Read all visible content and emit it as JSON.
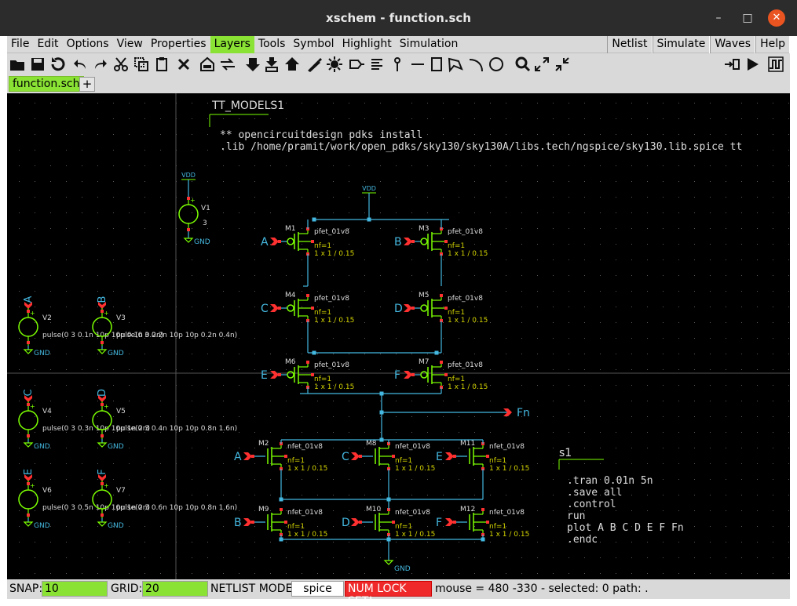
{
  "window": {
    "title": "xschem - function.sch",
    "minimize": "–",
    "maximize": "□",
    "close": "✕"
  },
  "menu": {
    "items": [
      "File",
      "Edit",
      "Options",
      "View",
      "Properties",
      "Layers",
      "Tools",
      "Symbol",
      "Highlight",
      "Simulation"
    ],
    "active": "Layers",
    "right_buttons": [
      "Netlist",
      "Simulate",
      "Waves",
      "Help"
    ]
  },
  "toolbar": {
    "icons": [
      "open-folder-icon",
      "save-icon",
      "reload-icon",
      "undo-icon",
      "redo-icon",
      "cut-icon",
      "copy-icon",
      "paste-icon",
      "delete-icon",
      "place-symbol-icon",
      "move-icon",
      "push-down-icon",
      "make-symbol-icon",
      "pop-up-icon",
      "draw-wire-icon",
      "highlight-net-icon",
      "place-pin-icon",
      "netlabel-icon",
      "place-label-icon",
      "draw-line-icon",
      "draw-rect-icon",
      "draw-polygon-icon",
      "draw-arc-icon",
      "draw-circle-icon",
      "zoom-icon",
      "zoom-in-icon",
      "zoom-out-icon",
      "netlist-icon",
      "simulate-icon",
      "waves-icon"
    ]
  },
  "tabs": [
    {
      "label": "function.sch",
      "active": true
    }
  ],
  "tab_add": "+",
  "schematic": {
    "tt_models_label": "TT_MODELS1",
    "pdk_line1": "** opencircuitdesign pdks install",
    "pdk_line2": ".lib /home/pramit/work/open_pdks/sky130/sky130A/libs.tech/ngspice/sky130.lib.spice tt",
    "vdd": "VDD",
    "gnd": "GND",
    "v1_name": "V1",
    "v1_value": "3",
    "sources": [
      {
        "name": "V2",
        "label": "A",
        "value": "pulse(0 3 0.1n 10p 10p 0.1n 0.2n)"
      },
      {
        "name": "V3",
        "label": "B",
        "value": "pulse(0 3 0.2n 10p 10p 0.2n 0.4n)"
      },
      {
        "name": "V4",
        "label": "C",
        "value": "pulse(0 3 0.3n 10p 10p 1n 2n)"
      },
      {
        "name": "V5",
        "label": "D",
        "value": "pulse(0 3 0.4n 10p 10p 0.8n 1.6n)"
      },
      {
        "name": "V6",
        "label": "E",
        "value": "pulse(0 3 0.5n 10p 10p 1n 2n)"
      },
      {
        "name": "V7",
        "label": "F",
        "value": "pulse(0 3 0.6n 10p 10p 0.8n 1.6n)"
      }
    ],
    "pmos": [
      {
        "name": "M1",
        "gate": "A"
      },
      {
        "name": "M3",
        "gate": "B"
      },
      {
        "name": "M4",
        "gate": "C"
      },
      {
        "name": "M5",
        "gate": "D"
      },
      {
        "name": "M6",
        "gate": "E"
      },
      {
        "name": "M7",
        "gate": "F"
      }
    ],
    "nmos": [
      {
        "name": "M2",
        "gate": "A"
      },
      {
        "name": "M8",
        "gate": "C"
      },
      {
        "name": "M11",
        "gate": "E"
      },
      {
        "name": "M9",
        "gate": "B"
      },
      {
        "name": "M10",
        "gate": "D"
      },
      {
        "name": "M12",
        "gate": "F"
      }
    ],
    "pmos_model": "pfet_01v8",
    "nmos_model": "nfet_01v8",
    "nf": "nf=1",
    "size": "1 x 1 / 0.15",
    "output": "Fn",
    "sim_block_name": "s1",
    "sim_commands": [
      ".tran 0.01n 5n",
      ".save all",
      ".control",
      "run",
      "plot A B C D E F Fn",
      ".endc"
    ]
  },
  "status": {
    "snap_label": "SNAP:",
    "snap_value": "10",
    "grid_label": "GRID:",
    "grid_value": "20",
    "netlist_mode_label": "NETLIST MODE:",
    "netlist_mode_value": "spice",
    "numlock": "NUM LOCK SET!",
    "info": "mouse = 480 -330 - selected: 0 path: ."
  },
  "colors": {
    "wire": "#44b8e0",
    "symbol": "#7cff00",
    "pin": "#ff3030",
    "accent_green": "#8ae234",
    "label_text": "#d4d400"
  }
}
